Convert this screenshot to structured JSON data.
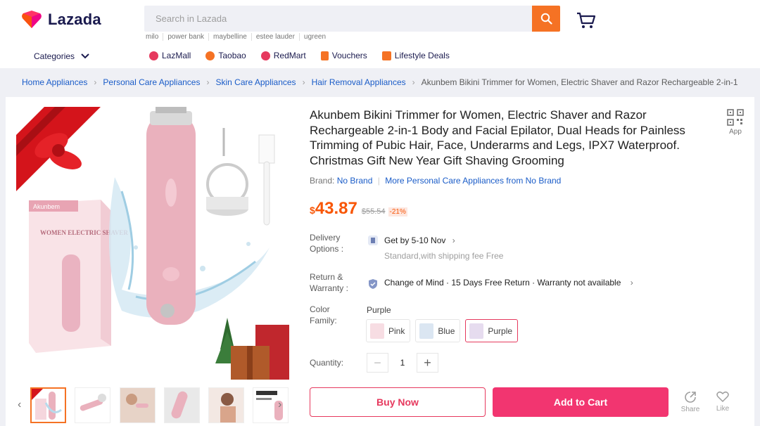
{
  "header": {
    "logo_text": "Lazada",
    "search_placeholder": "Search in Lazada",
    "suggestions": [
      "milo",
      "power bank",
      "maybelline",
      "estee lauder",
      "ugreen"
    ],
    "categories_label": "Categories",
    "nav": [
      {
        "label": "LazMall",
        "icon": "lazmall-icon",
        "color": "#e6395e"
      },
      {
        "label": "Taobao",
        "icon": "taobao-icon",
        "color": "#f57224"
      },
      {
        "label": "RedMart",
        "icon": "redmart-icon",
        "color": "#e6395e"
      },
      {
        "label": "Vouchers",
        "icon": "voucher-icon",
        "color": "#f57224"
      },
      {
        "label": "Lifestyle Deals",
        "icon": "lifestyle-icon",
        "color": "#f57224"
      }
    ]
  },
  "breadcrumb": [
    "Home Appliances",
    "Personal Care Appliances",
    "Skin Care Appliances",
    "Hair Removal Appliances",
    "Akunbem Bikini Trimmer for Women, Electric Shaver and Razor Rechargeable 2-in-1"
  ],
  "product": {
    "title": "Akunbem Bikini Trimmer for Women, Electric Shaver and Razor Rechargeable 2-in-1 Body and Facial Epilator, Dual Heads for Painless Trimming of Pubic Hair, Face, Underarms and Legs, IPX7 Waterproof. Christmas Gift New Year Gift Shaving Grooming",
    "app_label": "App",
    "brand_label": "Brand:",
    "brand_value": "No Brand",
    "brand_more": "More Personal Care Appliances from No Brand",
    "currency": "$",
    "price": "43.87",
    "original_price": "$55.54",
    "discount": "-21%",
    "delivery_label": "Delivery Options :",
    "delivery_value": "Get by 5-10 Nov",
    "delivery_sub": "Standard,with shipping fee Free",
    "return_label": "Return & Warranty :",
    "return_value": "Change of Mind · 15 Days Free Return · Warranty not available",
    "color_label": "Color Family:",
    "color_selected": "Purple",
    "variants": [
      "Pink",
      "Blue",
      "Purple"
    ],
    "quantity_label": "Quantity:",
    "quantity": "1",
    "buy_now": "Buy Now",
    "add_to_cart": "Add to Cart",
    "share_label": "Share",
    "like_label": "Like",
    "box_text": "WOMEN ELECTRIC SHAVER",
    "box_brand": "Akunbem"
  },
  "colors": {
    "accent_orange": "#f57224",
    "price_orange": "#f85606",
    "cart_pink": "#f23570",
    "link_blue": "#1a5cc8"
  }
}
